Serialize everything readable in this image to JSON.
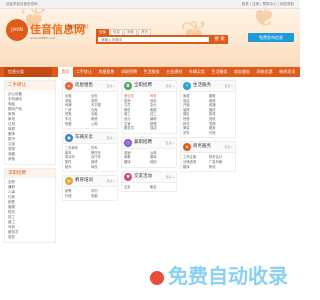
{
  "topbar": {
    "welcome": "欢迎来到佳音信息网",
    "right": "登录 | 注册 | 帮助中心 | 网站导航"
  },
  "logo": {
    "badge": "JIAYIN",
    "name": "佳音信息网",
    "url": "www.0088cn.net"
  },
  "city": {
    "name": "南阳",
    "switch": "[切换]"
  },
  "search": {
    "tabs": [
      "全部",
      "信息",
      "商家",
      "资讯"
    ],
    "active_tab": 0,
    "placeholder": "请输入关键词",
    "button": "搜 索"
  },
  "post_button": "免费发布信息",
  "nav": {
    "category_title": "信息分类",
    "items": [
      "首页",
      "二手转让",
      "房屋租售",
      "求职招聘",
      "生活服务",
      "五金建材",
      "车辆买卖",
      "生活服务",
      "商务服务",
      "网络优惠",
      "新闻资讯",
      "商品",
      "店铺"
    ],
    "active": 0
  },
  "sidebar": [
    {
      "title": "二手转让",
      "items": [
        "办公设备",
        "手机通讯",
        "电脑",
        "数码产品",
        "家具",
        "家电",
        "日用",
        "母婴",
        "服饰",
        "图书",
        "文体",
        "宠物",
        "收藏",
        "其他"
      ]
    },
    {
      "title": "求职招聘",
      "items": [
        "全职",
        "兼职",
        "人事",
        "行政",
        "销售",
        "客服",
        "财务",
        "技工",
        "普工",
        "司机",
        "服务员",
        "保安"
      ]
    }
  ],
  "columns": [
    [
      {
        "title": "房屋租售",
        "icon": "home-icon",
        "color": "#e06b3a",
        "more": "更多>",
        "items": [
          "出租",
          "出售",
          "求租",
          "求购",
          "商铺",
          "写字楼",
          "厂房",
          "仓库",
          "短租",
          "合租",
          "车位",
          "新房",
          "别墅",
          "公寓"
        ]
      },
      {
        "title": "车辆买卖",
        "icon": "car-icon",
        "color": "#3a7fc4",
        "more": "更多>",
        "items": [
          "二手轿车",
          "货车",
          "客车",
          "摩托车",
          "电动车",
          "自行车",
          "配件",
          "维修",
          "租车",
          "驾校"
        ]
      },
      {
        "title": "教育培训",
        "icon": "book-icon",
        "color": "#e0a53a",
        "more": "更多>",
        "items": [
          "家教",
          "学历",
          "外语",
          "电脑"
        ]
      }
    ],
    [
      {
        "title": "全职招聘",
        "icon": "briefcase-icon",
        "color": "#4aa85c",
        "more": "更多>",
        "items": [
          "营业员",
          "司机",
          "厨师",
          "保安",
          "文员",
          "会计",
          "销售",
          "客服",
          "普工",
          "技工",
          "设计",
          "编辑",
          "主管",
          "助理",
          "服务员",
          "保洁"
        ]
      },
      {
        "title": "兼职招聘",
        "icon": "clock-icon",
        "color": "#8a5ac4",
        "more": "更多>",
        "items": [
          "促销",
          "派单",
          "家教",
          "模特",
          "翻译",
          "其他"
        ]
      },
      {
        "title": "交友活动",
        "icon": "heart-icon",
        "color": "#d44a7a",
        "more": "更多>",
        "items": [
          "交友",
          "聚会"
        ]
      }
    ],
    [
      {
        "title": "生活服务",
        "icon": "service-icon",
        "color": "#2a9fd6",
        "more": "更多>",
        "items": [
          "家政",
          "搬家",
          "保洁",
          "维修",
          "开锁",
          "疏通",
          "装修",
          "婚庆",
          "摄影",
          "旅游",
          "快递",
          "回收",
          "鲜花",
          "宠物",
          "美容",
          "健身",
          "洗车",
          "代驾"
        ]
      },
      {
        "title": "商务服务",
        "icon": "store-icon",
        "color": "#e05b1a",
        "more": "更多>",
        "items": [
          "工商注册",
          "财务会计",
          "法律咨询",
          "广告印刷",
          "翻译",
          "物流"
        ]
      }
    ]
  ],
  "watermark": "免费自动收录"
}
